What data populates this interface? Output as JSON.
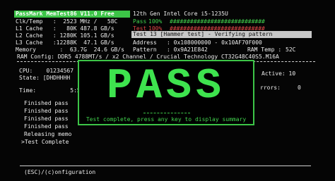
{
  "header": {
    "title": "PassMark MemTest86 V11.0 Free",
    "cpu_name": "12th Gen Intel Core i5-1235U"
  },
  "system": [
    {
      "label": "Clk/Temp",
      "value": " :  2523 MHz /   58C"
    },
    {
      "label": "L1 Cache",
      "value": " :   80K 487.8 GB/s"
    },
    {
      "label": "L2 Cache",
      "value": " : 1280K 105.1 GB/s"
    },
    {
      "label": "L3 Cache",
      "value": " :12288K  47.1 GB/s"
    },
    {
      "label": "Memory",
      "value": "   :  63.7G  24.6 GB/s"
    }
  ],
  "progress": [
    {
      "label": "Pass",
      "value": "100%",
      "bar": "############################",
      "color": "#41d34e"
    },
    {
      "label": "Test",
      "value": "100%",
      "bar": "############################",
      "color": "#e24747"
    }
  ],
  "current_test": "Test 13 [Hammer test] - Verifying pattern",
  "address": {
    "label": "Address",
    "value": ": 0x108000000 - 0x10AF70F000"
  },
  "pattern": {
    "label": "Pattern",
    "value": ": 0x9A21E842",
    "ram_temp_label": "RAM Temp :",
    "ram_temp_value": "52C"
  },
  "ram_config": "RAM Config: DDR5 4788MT/s / x2 Channel / Crucial Technology CT32G48C40S5.M16A",
  "left_panel": {
    "cpu": "CPU:    01234567",
    "state": "State: [DHDHHHH",
    "time": "Time:          5:53:",
    "active": "Active: 10",
    "errors": "rrors:     0",
    "log": [
      "Finished pass",
      "Finished pass",
      "Finished pass",
      "Finished pass",
      "Releasing memo",
      ">Test Complete"
    ]
  },
  "dialog": {
    "big_text": "PASS",
    "message": "Test complete, press any key to display summary"
  },
  "footer": {
    "hint": "(ESC)/(c)onfiguration"
  }
}
